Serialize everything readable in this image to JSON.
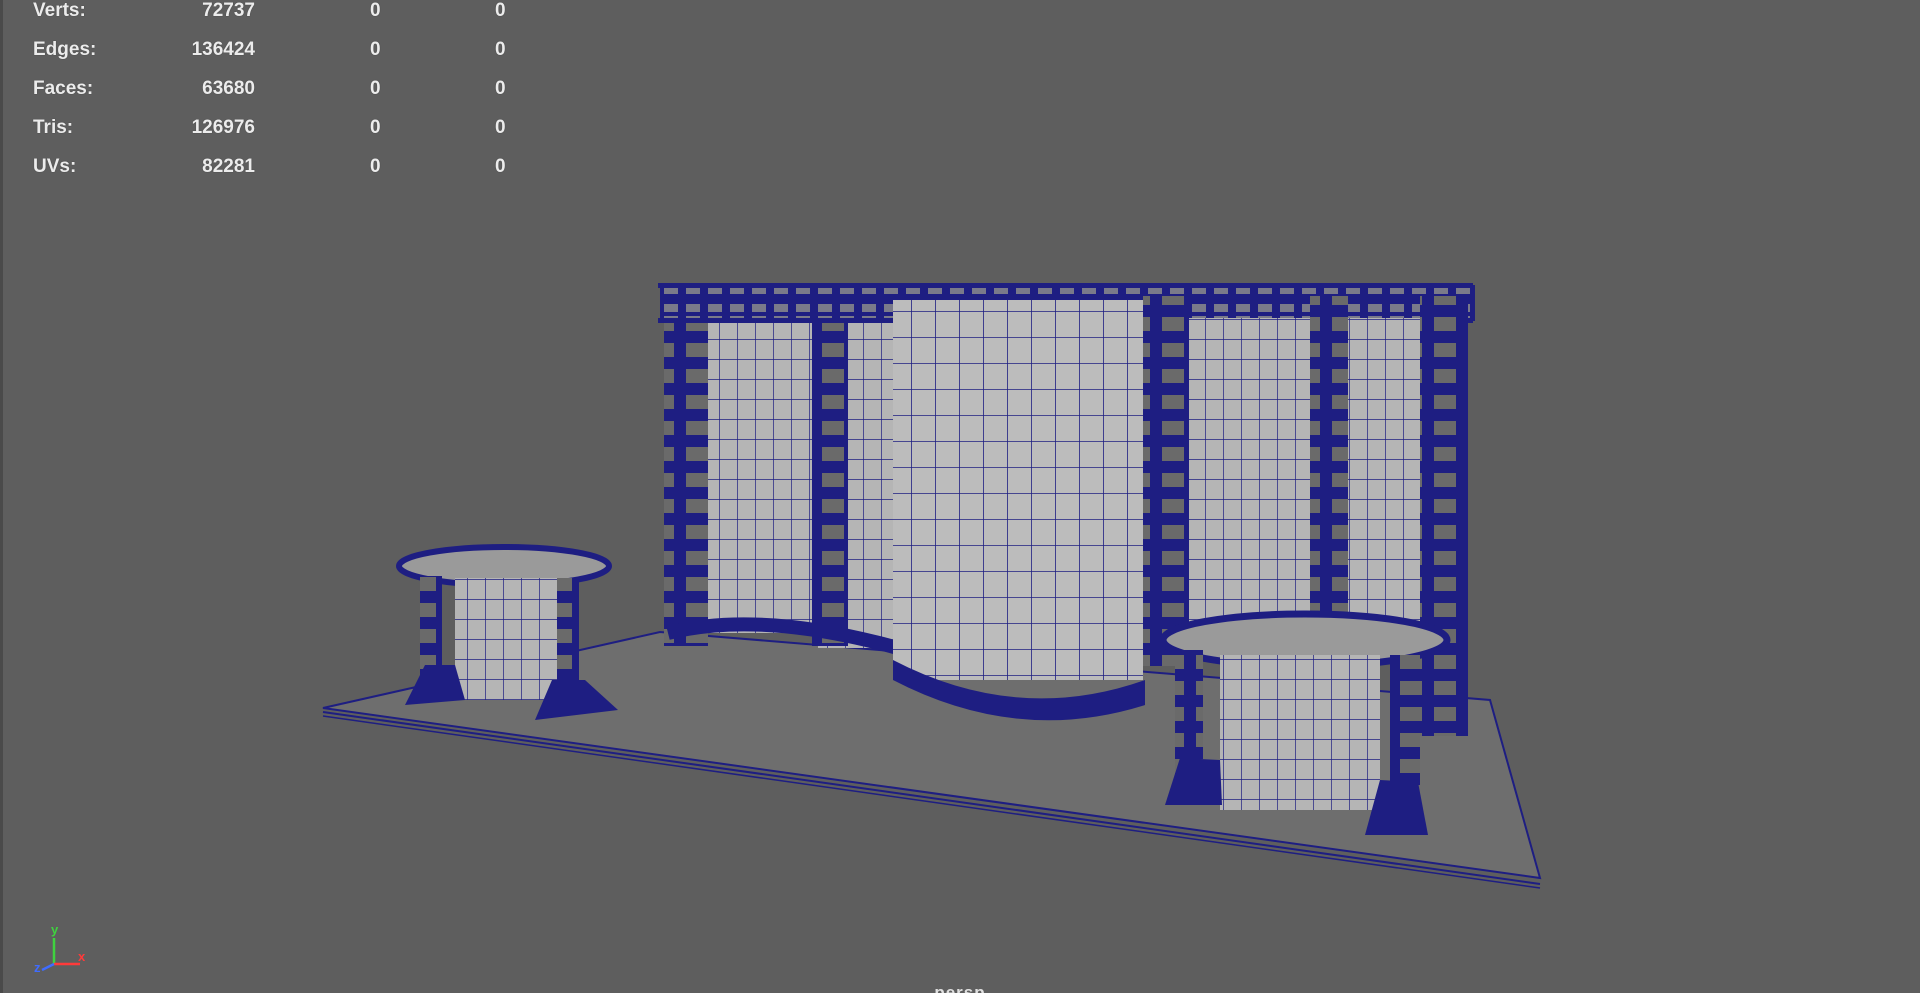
{
  "viewport": {
    "background_color": "#5e5e5e",
    "wireframe_color": "#1e1e82",
    "surface_color": "#b9b9b9",
    "camera_label": "persp"
  },
  "hud": {
    "rows": [
      {
        "label": "Verts:",
        "total": "72737",
        "selected": "0",
        "component": "0"
      },
      {
        "label": "Edges:",
        "total": "136424",
        "selected": "0",
        "component": "0"
      },
      {
        "label": "Faces:",
        "total": "63680",
        "selected": "0",
        "component": "0"
      },
      {
        "label": "Tris:",
        "total": "126976",
        "selected": "0",
        "component": "0"
      },
      {
        "label": "UVs:",
        "total": "82281",
        "selected": "0",
        "component": "0"
      }
    ]
  },
  "axis_gizmo": {
    "y_label": "y",
    "z_label": "z",
    "x_label": "x",
    "y_color": "#3fd23f",
    "z_color": "#3f6cff",
    "x_color": "#ff3a3a"
  }
}
